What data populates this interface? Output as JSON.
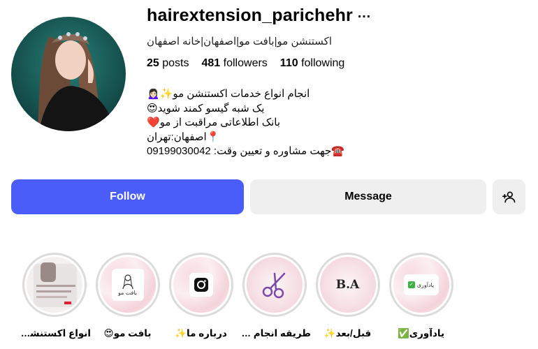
{
  "profile": {
    "username": "hairextension_parichehr",
    "more_icon": "…",
    "category": "اکستنشن مو|بافت مو|اصفهان|خانه اصفهان",
    "stats": {
      "posts_count": "25",
      "posts_label": "posts",
      "followers_count": "481",
      "followers_label": "followers",
      "following_count": "110",
      "following_label": "following"
    },
    "bio": [
      "انجام انواع خدمات اکستنشن مو✨🙍🏻‍♀️",
      "یک شبه گیسو کمند شوید😍",
      "بانک اطلاعاتی مراقبت از مو❤️",
      "📍اصفهان:تهران",
      "☎️جهت مشاوره و تعیین وقت: 09199030042"
    ]
  },
  "actions": {
    "follow_label": "Follow",
    "message_label": "Message",
    "add_user_icon": "add-user-icon"
  },
  "highlights": [
    {
      "label": "انواع اکستنشن...",
      "thumb_text": ""
    },
    {
      "label": "بافت مو😍",
      "thumb_text": "بافت مو"
    },
    {
      "label": "درباره ما✨",
      "thumb_text": ""
    },
    {
      "label": "طریقه انجام کا...",
      "thumb_text": ""
    },
    {
      "label": "قبل/بعد✨",
      "thumb_text": "B.A"
    },
    {
      "label": "یادآوری✅",
      "thumb_text": "یادآوری"
    }
  ],
  "colors": {
    "follow_bg": "#4a5df9",
    "secondary_bg": "#efefef",
    "ring": "#dbdbdb"
  }
}
